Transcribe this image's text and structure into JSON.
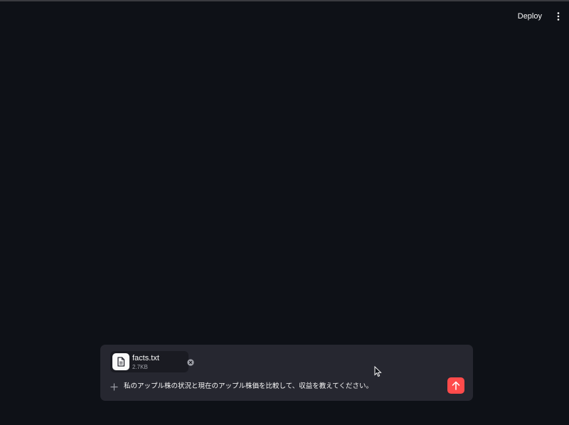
{
  "header": {
    "deploy_label": "Deploy",
    "menu_icon": "more-vertical-icon"
  },
  "chat": {
    "attachment": {
      "name": "facts.txt",
      "size": "2.7KB",
      "icon": "file-document-icon"
    },
    "input_value": "私のアップル株の状況と現在のアップル株価を比較して、収益を教えてください。",
    "add_icon": "plus-icon",
    "send_icon": "arrow-up-icon"
  },
  "colors": {
    "background": "#0e1117",
    "chat_box": "#262730",
    "accent": "#ff4b4b",
    "text": "#fafafa"
  }
}
